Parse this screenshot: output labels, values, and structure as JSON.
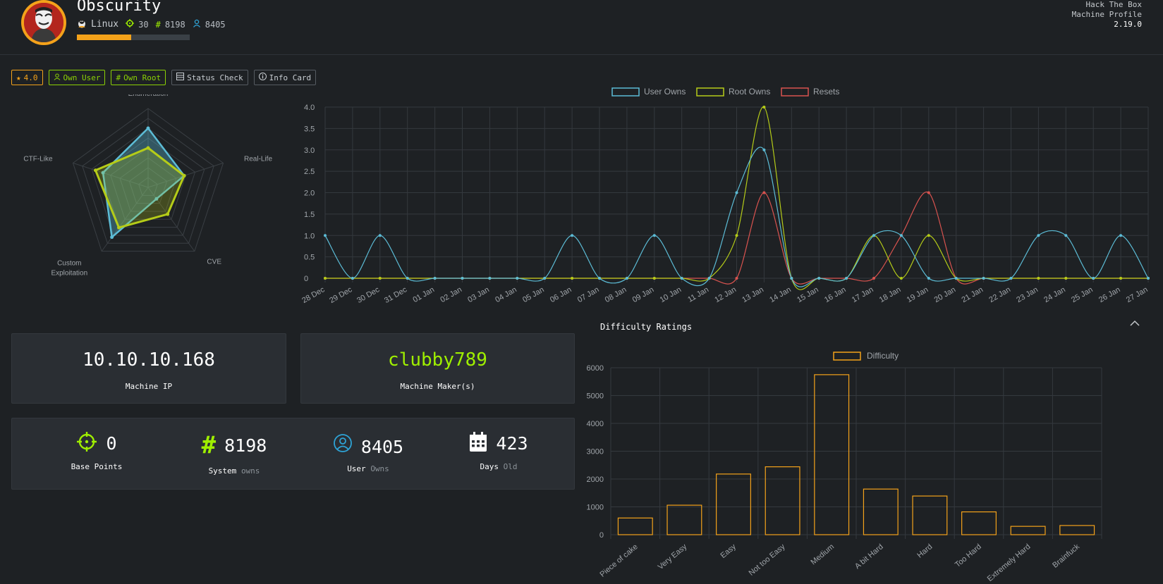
{
  "header": {
    "machine_name": "Obscurity",
    "os": "Linux",
    "points": "30",
    "system_owns": "8198",
    "user_owns": "8405",
    "rating_progress": 0.48,
    "brand_line1": "Hack The Box",
    "brand_line2": "Machine Profile",
    "version": "2.19.0"
  },
  "toolbar": {
    "rating": "4.0",
    "own_user": "Own User",
    "own_root": "Own Root",
    "status_check": "Status Check",
    "info_card": "Info Card"
  },
  "colors": {
    "background": "#1e2124",
    "panel": "#2a2e33",
    "accent_green": "#9fef00",
    "accent_orange": "#f4a21a",
    "user_blue": "#5cbcd6",
    "root_yellow": "#b5cc18",
    "resets_red": "#d9534f"
  },
  "info": {
    "ip": "10.10.10.168",
    "ip_label": "Machine IP",
    "maker": "clubby789",
    "maker_label": "Machine Maker(s)"
  },
  "stats": {
    "base_points": "0",
    "base_points_label": "Base Points",
    "system": "8198",
    "system_label": "System",
    "system_suffix": "owns",
    "user": "8405",
    "user_label": "User",
    "user_suffix": "Owns",
    "days": "423",
    "days_label": "Days",
    "days_suffix": "Old"
  },
  "difficulty_section": {
    "title": "Difficulty Ratings"
  },
  "chart_data": [
    {
      "type": "radar",
      "axes": [
        "Enumeration",
        "Real-Life",
        "CVE",
        "Custom Exploitation",
        "CTF-Like"
      ],
      "series": [
        {
          "values": [
            0.75,
            0.48,
            0.18,
            0.78,
            0.6
          ]
        },
        {
          "values": [
            0.5,
            0.48,
            0.42,
            0.63,
            0.7
          ]
        }
      ]
    },
    {
      "type": "line",
      "x": [
        "28 Dec",
        "29 Dec",
        "30 Dec",
        "31 Dec",
        "01 Jan",
        "02 Jan",
        "03 Jan",
        "04 Jan",
        "05 Jan",
        "06 Jan",
        "07 Jan",
        "08 Jan",
        "09 Jan",
        "10 Jan",
        "11 Jan",
        "12 Jan",
        "13 Jan",
        "14 Jan",
        "15 Jan",
        "16 Jan",
        "17 Jan",
        "18 Jan",
        "19 Jan",
        "20 Jan",
        "21 Jan",
        "22 Jan",
        "23 Jan",
        "24 Jan",
        "25 Jan",
        "26 Jan",
        "27 Jan"
      ],
      "ylim": [
        0,
        4
      ],
      "yticks": [
        "0",
        "0.5",
        "1.0",
        "1.5",
        "2.0",
        "2.5",
        "3.0",
        "3.5",
        "4.0"
      ],
      "grid": true,
      "legend": "top",
      "series": [
        {
          "name": "User Owns",
          "values": [
            1,
            0,
            1,
            0,
            0,
            0,
            0,
            0,
            0,
            1,
            0,
            0,
            1,
            0,
            0,
            2,
            3,
            0,
            0,
            0,
            1,
            1,
            0,
            0,
            0,
            0,
            1,
            1,
            0,
            1,
            0
          ]
        },
        {
          "name": "Root Owns",
          "values": [
            0,
            0,
            0,
            0,
            0,
            0,
            0,
            0,
            0,
            0,
            0,
            0,
            0,
            0,
            0,
            1,
            4,
            0,
            0,
            0,
            1,
            0,
            1,
            0,
            0,
            0,
            0,
            0,
            0,
            0,
            0
          ]
        },
        {
          "name": "Resets",
          "values": [
            0,
            0,
            0,
            0,
            0,
            0,
            0,
            0,
            0,
            0,
            0,
            0,
            0,
            0,
            0,
            0,
            2,
            0,
            0,
            0,
            0,
            1,
            2,
            0,
            0,
            0,
            0,
            0,
            0,
            0,
            0
          ]
        }
      ]
    },
    {
      "type": "bar",
      "categories": [
        "Piece of cake",
        "Very Easy",
        "Easy",
        "Not too Easy",
        "Medium",
        "A bit Hard",
        "Hard",
        "Too Hard",
        "Extremely Hard",
        "Brainfuck"
      ],
      "series": [
        {
          "name": "Difficulty",
          "values": [
            600,
            1060,
            2180,
            2440,
            5750,
            1640,
            1390,
            820,
            300,
            330
          ]
        }
      ],
      "ylim": [
        0,
        6000
      ],
      "yticks": [
        "0",
        "1000",
        "2000",
        "3000",
        "4000",
        "5000",
        "6000"
      ],
      "grid": true,
      "legend": "top"
    }
  ]
}
